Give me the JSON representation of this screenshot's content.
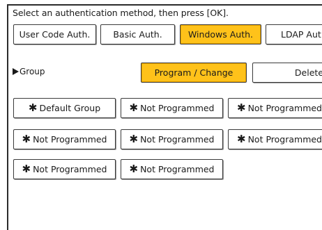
{
  "instruction": "Select an authentication method, then press [OK].",
  "auth_tabs": [
    {
      "label": "User Code Auth.",
      "selected": false
    },
    {
      "label": "Basic Auth.",
      "selected": false
    },
    {
      "label": "Windows Auth.",
      "selected": true
    },
    {
      "label": "LDAP Aut",
      "selected": false
    }
  ],
  "group": {
    "label": "Group",
    "program_change_label": "Program / Change",
    "delete_label": "Delete"
  },
  "group_slots": [
    {
      "symbol": "✱",
      "label": "Default Group"
    },
    {
      "symbol": "✱",
      "label": "Not Programmed"
    },
    {
      "symbol": "✱",
      "label": "Not Programmed"
    },
    {
      "symbol": "✱",
      "label": "Not Programmed"
    },
    {
      "symbol": "✱",
      "label": "Not Programmed"
    },
    {
      "symbol": "✱",
      "label": "Not Programmed"
    },
    {
      "symbol": "✱",
      "label": "Not Programmed"
    },
    {
      "symbol": "✱",
      "label": "Not Programmed"
    }
  ],
  "colors": {
    "selected": "#ffc21a",
    "border": "#3a3a3a",
    "background": "#ffffff"
  }
}
